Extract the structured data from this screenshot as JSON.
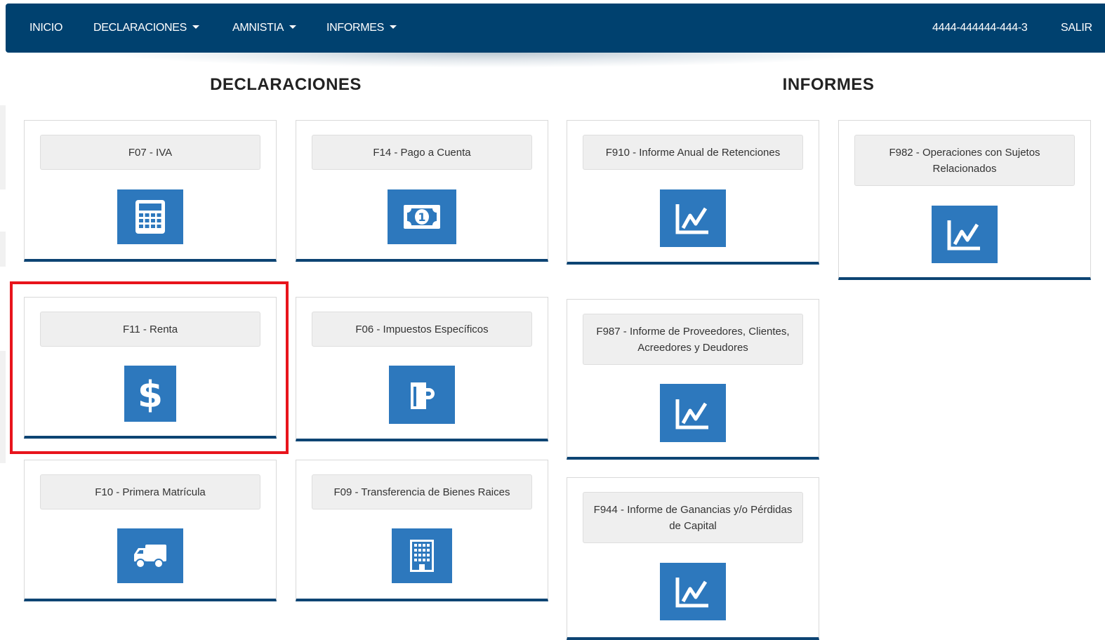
{
  "nav": {
    "items": [
      {
        "label": "INICIO",
        "dropdown": false
      },
      {
        "label": "DECLARACIONES",
        "dropdown": true
      },
      {
        "label": "AMNISTIA",
        "dropdown": true
      },
      {
        "label": "INFORMES",
        "dropdown": true
      }
    ],
    "user_id": "4444-444444-444-3",
    "logout_label": "SALIR"
  },
  "sections": {
    "declaraciones_title": "DECLARACIONES",
    "informes_title": "INFORMES"
  },
  "declaraciones": [
    {
      "label": "F07 - IVA",
      "icon": "calculator-icon"
    },
    {
      "label": "F14 - Pago a Cuenta",
      "icon": "money-bill-icon"
    },
    {
      "label": "F11 - Renta",
      "icon": "dollar-icon",
      "highlighted": true
    },
    {
      "label": "F06 - Impuestos Específicos",
      "icon": "beer-mug-icon"
    },
    {
      "label": "F10 - Primera Matrícula",
      "icon": "truck-icon"
    },
    {
      "label": "F09 - Transferencia de Bienes Raices",
      "icon": "building-icon"
    }
  ],
  "informes": [
    {
      "label": "F910 - Informe Anual de Retenciones",
      "icon": "line-chart-icon"
    },
    {
      "label": "F982 - Operaciones con Sujetos Relacionados",
      "icon": "line-chart-icon"
    },
    {
      "label": "F987 - Informe de Proveedores, Clientes, Acreedores y Deudores",
      "icon": "line-chart-icon"
    },
    {
      "label": "F944 - Informe de Ganancias y/o Pérdidas de Capital",
      "icon": "line-chart-icon"
    }
  ],
  "colors": {
    "navbar": "#00416f",
    "icon_tile": "#2d78bd",
    "card_bottom_border": "#0d4473",
    "highlight": "#e8141c"
  }
}
